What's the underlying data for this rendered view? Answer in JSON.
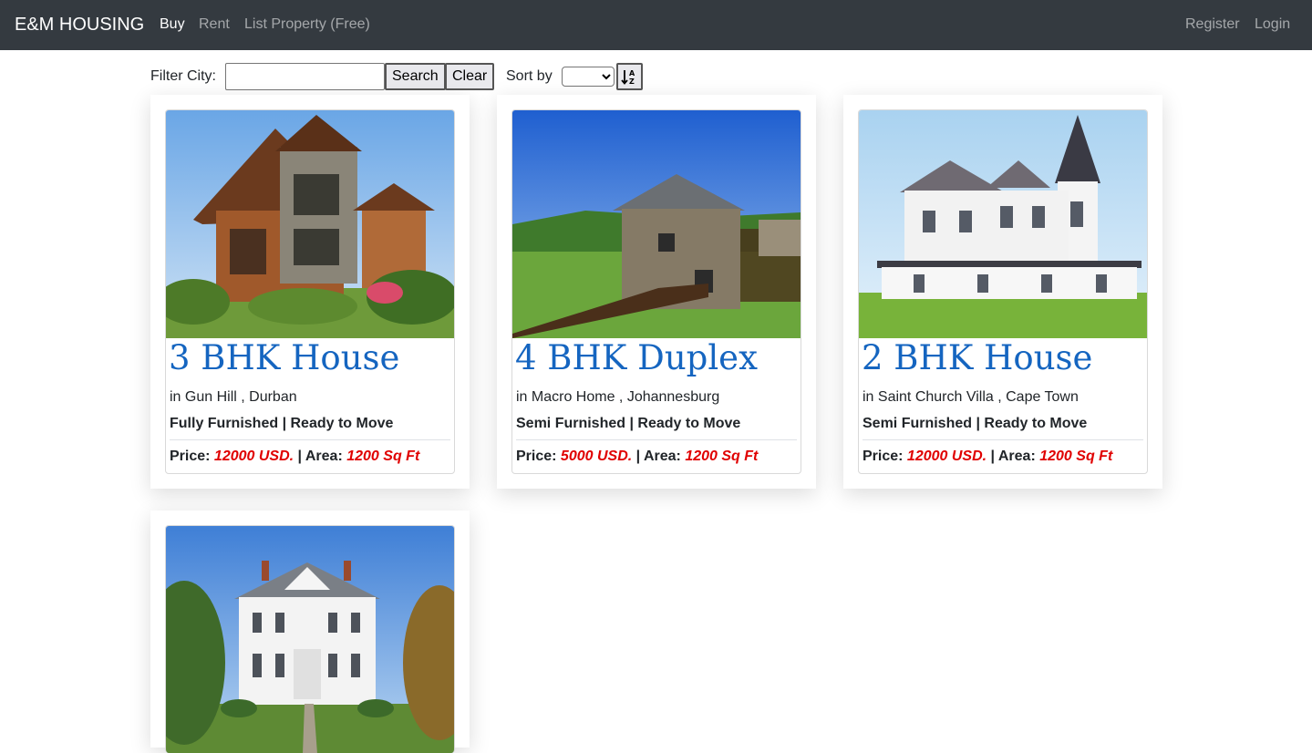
{
  "navbar": {
    "brand": "E&M HOUSING",
    "links": [
      {
        "label": "Buy",
        "active": true
      },
      {
        "label": "Rent",
        "active": false
      },
      {
        "label": "List Property (Free)",
        "active": false
      }
    ],
    "right_links": [
      {
        "label": "Register"
      },
      {
        "label": "Login"
      }
    ]
  },
  "filter": {
    "label": "Filter City:",
    "city_value": "",
    "search_label": "Search",
    "clear_label": "Clear",
    "sort_label": "Sort by",
    "sort_selected": "",
    "sort_icon": "sort-alpha-desc-icon"
  },
  "listings": [
    {
      "title": "3 BHK House",
      "location": "in Gun Hill , Durban",
      "furnishing": "Fully Furnished | Ready to Move",
      "price_label": "Price:",
      "price": "12000 USD.",
      "area_label": "| Area:",
      "area": "1200 Sq Ft"
    },
    {
      "title": "4 BHK Duplex",
      "location": "in Macro Home , Johannesburg",
      "furnishing": "Semi Furnished | Ready to Move",
      "price_label": "Price:",
      "price": "5000 USD.",
      "area_label": "| Area:",
      "area": "1200 Sq Ft"
    },
    {
      "title": "2 BHK House",
      "location": "in Saint Church Villa , Cape Town",
      "furnishing": "Semi Furnished | Ready to Move",
      "price_label": "Price:",
      "price": "12000 USD.",
      "area_label": "| Area:",
      "area": "1200 Sq Ft"
    },
    {
      "title": "",
      "location": "",
      "furnishing": "",
      "price_label": "",
      "price": "",
      "area_label": "",
      "area": ""
    }
  ],
  "colors": {
    "navbar_bg": "#343a40",
    "title_blue": "#1565c0",
    "price_red": "#e00000"
  }
}
